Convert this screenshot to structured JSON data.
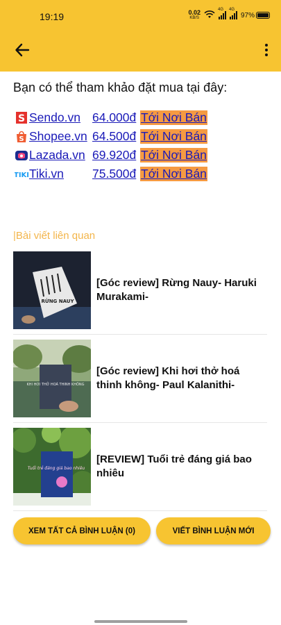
{
  "status_bar": {
    "time": "19:19",
    "net_speed_value": "0.02",
    "net_speed_unit": "KB/S",
    "signal_label_1": "4G",
    "signal_label_2": "4G",
    "battery": "97%",
    "icons": [
      "wifi-icon",
      "signal-icon",
      "signal-icon",
      "battery-icon"
    ]
  },
  "app_bar": {
    "background": "#f7c431",
    "back_icon": "arrow-left-icon",
    "menu_icon": "more-vertical-icon"
  },
  "intro_text": "Bạn có thể tham khảo đặt mua tại đây:",
  "shops": [
    {
      "name": "Sendo.vn",
      "price": "64.000đ",
      "action": "Tới Nơi Bán",
      "icon": "sendo-logo-icon",
      "color": "#e5322d"
    },
    {
      "name": "Shopee.vn",
      "price": "64.500đ",
      "action": "Tới Nơi Bán",
      "icon": "shopee-logo-icon",
      "color": "#f05d32"
    },
    {
      "name": "Lazada.vn",
      "price": "69.920đ",
      "action": "Tới Nơi Bán",
      "icon": "lazada-logo-icon",
      "color": "#e0245e"
    },
    {
      "name": "Tiki.vn",
      "price": "75.500đ",
      "action": "Tới Nơi Bán",
      "icon": "tiki-logo-icon",
      "color": "#1a9cf2"
    }
  ],
  "related": {
    "title": "|Bài viết liên quan",
    "articles": [
      {
        "title": "[Góc review] Rừng Nauy- Haruki Murakami-",
        "thumb_text": "RỪNG NAUY"
      },
      {
        "title": "[Góc review] Khi hơi thở hoá thinh không- Paul Kalanithi-",
        "thumb_text": "KHI HƠI THỞ HOÁ THINH KHÔNG"
      },
      {
        "title": "[REVIEW] Tuổi trẻ đáng giá bao nhiêu",
        "thumb_text": "Tuổi trẻ đáng giá bao nhiêu"
      }
    ]
  },
  "buttons": {
    "view_all_comments": "XEM TẤT CẢ BÌNH LUẬN (0)",
    "write_comment": "VIẾT BÌNH LUẬN MỚI"
  },
  "colors": {
    "accent": "#f7c431",
    "link": "#1a1ab8",
    "link_highlight": "#f59a42",
    "section_title": "#f3b54a"
  }
}
